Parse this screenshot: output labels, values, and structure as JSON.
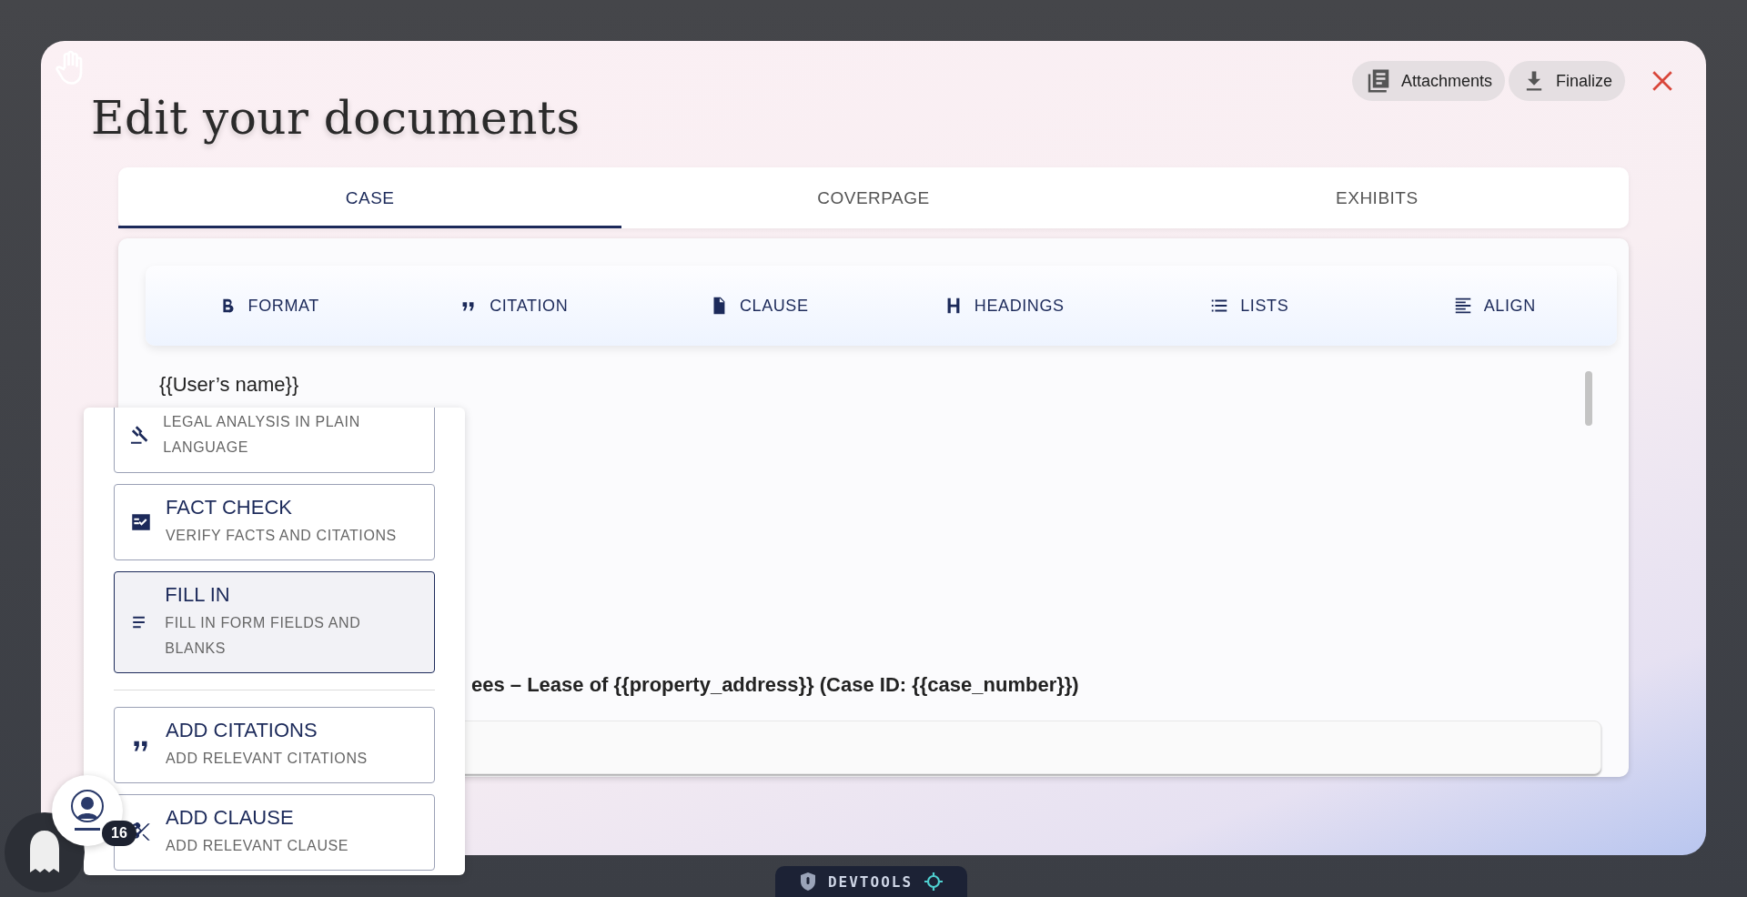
{
  "modal": {
    "title": "Edit your documents",
    "actions": [
      {
        "label": "Attachments",
        "kind": "attachments"
      },
      {
        "label": "Finalize",
        "kind": "download"
      }
    ]
  },
  "tabs": [
    {
      "label": "CASE",
      "selected": true
    },
    {
      "label": "COVERPAGE",
      "selected": false
    },
    {
      "label": "EXHIBITS",
      "selected": false
    }
  ],
  "toolbar": [
    {
      "label": "FORMAT",
      "kind": "bold"
    },
    {
      "label": "CITATION",
      "kind": "quote"
    },
    {
      "label": "CLAUSE",
      "kind": "document"
    },
    {
      "label": "HEADINGS",
      "kind": "heading"
    },
    {
      "label": "LISTS",
      "kind": "list"
    },
    {
      "label": "ALIGN",
      "kind": "align"
    }
  ],
  "editor": {
    "lines": [
      {
        "text": "{{User’s name}}",
        "kind": "plain"
      },
      {
        "text": "ees – Lease of {{property_address}} (Case ID: {{case_number}})",
        "kind": "bold"
      }
    ]
  },
  "menu": {
    "groups": [
      [
        {
          "subtitle": "LEGAL ANALYSIS IN PLAIN LANGUAGE",
          "kind": "gavel",
          "selected": false
        },
        {
          "title": "FACT CHECK",
          "subtitle": "VERIFY FACTS AND CITATIONS",
          "kind": "factcheck",
          "selected": false
        },
        {
          "title": "FILL IN",
          "subtitle": "FILL IN FORM FIELDS AND BLANKS",
          "kind": "lines",
          "selected": true
        }
      ],
      [
        {
          "title": "ADD CITATIONS",
          "subtitle": "ADD RELEVANT CITATIONS",
          "kind": "quote",
          "selected": false
        },
        {
          "title": "ADD CLAUSE",
          "subtitle": "ADD RELEVANT CLAUSE",
          "kind": "scissors",
          "selected": false
        }
      ]
    ]
  },
  "assistant": {
    "badge": "16"
  },
  "devtools": {
    "label": "DEVTOOLS"
  }
}
